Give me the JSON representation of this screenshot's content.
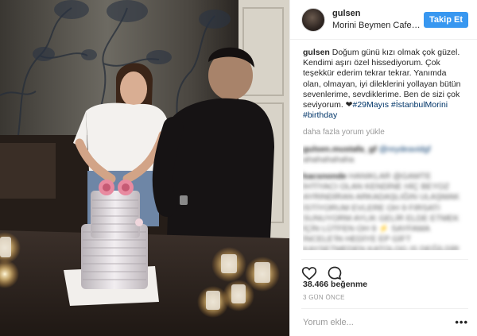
{
  "header": {
    "username": "gulsen",
    "location": "Morini Beymen Cafe…",
    "follow_label": "Takip Et"
  },
  "caption": {
    "username": "gulsen",
    "text": " Doğum günü kızı olmak çok güzel. Kendimi aşırı özel hissediyorum. Çok teşekkür ederim tekrar tekrar. Yanımda olan, olmayan, iyi dileklerini yollayan bütün sevenlerime, sevdiklerime. Ben de sizi çok seviyorum. ❤",
    "hashtags": "#29Mayıs #İstanbulMorini #birthday"
  },
  "load_more": "daha fazla yorum yükle",
  "comments": [
    {
      "username": "gulsen.mustafa_gf",
      "mention": "@reydeavidgf",
      "text": " ahahahahaha"
    },
    {
      "username": "kacsnonde",
      "text": " HANIKLAR @GAMTE İHTİYACI OLAN KENDİNE HİÇ BEYOZ AYRINDİRAN ARKADAŞLIĞIN ULAŞMAK İSTİYORUM EVLERE OH 9 FIRSATI SUNUYORM AYLIK GELİR ELDE ETMEK İÇİN LÜTFEN OH 9 ⚡ SAYFAMA İNCELE'İN HEDİYE EP GİFT KAYSETMEDEN KATOLOG IS DEĞİLDİR ❌"
    }
  ],
  "icons": {
    "like": "heart-icon",
    "comment": "comment-bubble-icon",
    "options": "more-options-icon"
  },
  "likes": "38.466 beğenme",
  "time_ago": "3 GÜN ÖNCE",
  "add_comment": {
    "placeholder": "Yorum ekle...",
    "options_label": "•••"
  },
  "colors": {
    "accent": "#3897f0",
    "hashtag": "#003569",
    "muted": "#999999"
  }
}
